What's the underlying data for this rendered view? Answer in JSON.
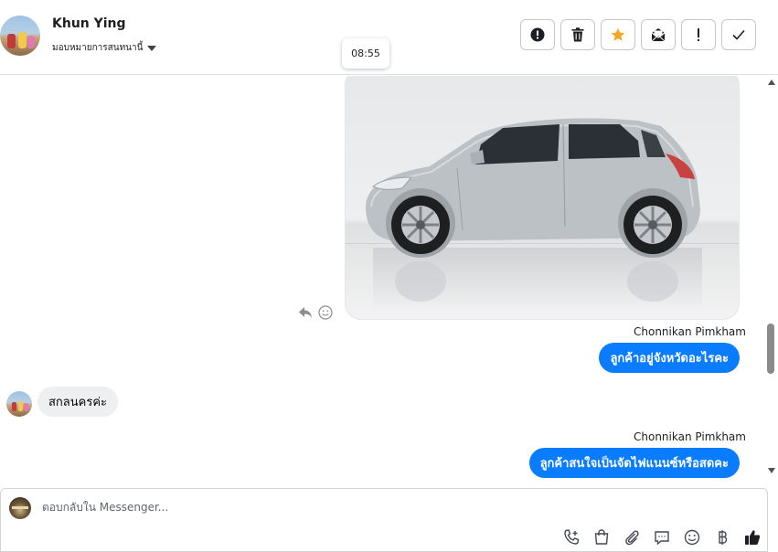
{
  "header": {
    "contact_name": "Khun Ying",
    "assign_label": "มอบหมายการสนทนานี้",
    "actions": [
      {
        "name": "report-spam-button",
        "icon": "alert-circle-icon"
      },
      {
        "name": "delete-button",
        "icon": "trash-icon"
      },
      {
        "name": "star-button",
        "icon": "star-icon"
      },
      {
        "name": "mark-unread-button",
        "icon": "envelope-icon"
      },
      {
        "name": "follow-up-button",
        "icon": "exclamation-icon"
      },
      {
        "name": "done-button",
        "icon": "checkmark-icon"
      }
    ]
  },
  "tooltip": {
    "time": "08:55"
  },
  "messages": [
    {
      "type": "image",
      "direction": "outgoing",
      "subject": "silver hatchback car photo"
    },
    {
      "type": "text",
      "direction": "outgoing",
      "sender": "Chonnikan Pimkham",
      "text": "ลูกค้าอยู่จังหวัดอะไรคะ"
    },
    {
      "type": "text",
      "direction": "incoming",
      "text": "สกลนครค่ะ"
    },
    {
      "type": "text",
      "direction": "outgoing",
      "sender": "Chonnikan Pimkham",
      "text": "ลูกค้าสนใจเป็นจัดไฟแนนซ์หรือสดคะ"
    }
  ],
  "composer": {
    "placeholder": "ตอบกลับใน Messenger...",
    "tools": [
      "phone-plus-icon",
      "shopping-bag-icon",
      "paperclip-icon",
      "saved-reply-icon",
      "emoji-icon",
      "baht-icon",
      "thumbs-up-icon"
    ]
  },
  "colors": {
    "accent": "#0a7cff",
    "star": "#f5a623",
    "incoming_bubble": "#eeeff1"
  }
}
